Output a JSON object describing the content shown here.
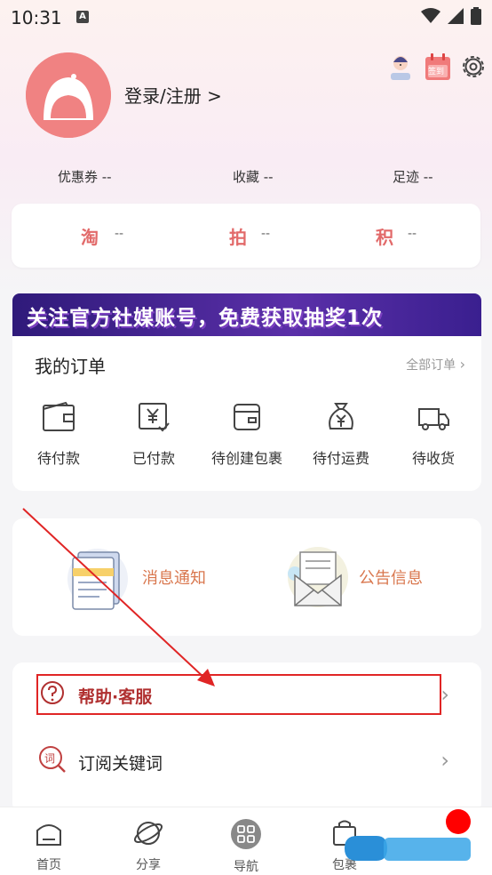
{
  "status_bar": {
    "time": "10:31",
    "notif_letter": "A"
  },
  "profile": {
    "login_text": "登录/注册 >"
  },
  "top_actions": {
    "signin_badge": "签到"
  },
  "stats": [
    {
      "label": "优惠券 --"
    },
    {
      "label": "收藏 --"
    },
    {
      "label": "足迹 --"
    }
  ],
  "tao_card": [
    {
      "name": "淘",
      "value": "--"
    },
    {
      "name": "拍",
      "value": "--"
    },
    {
      "name": "积",
      "value": "--"
    }
  ],
  "banner": {
    "text": "关注官方社媒账号，免费获取抽奖1次"
  },
  "orders": {
    "title": "我的订单",
    "all_label": "全部订单",
    "items": [
      {
        "label": "待付款",
        "icon": "wallet-icon"
      },
      {
        "label": "已付款",
        "icon": "paid-yen-icon"
      },
      {
        "label": "待创建包裹",
        "icon": "package-icon"
      },
      {
        "label": "待付运费",
        "icon": "money-bag-icon"
      },
      {
        "label": "待收货",
        "icon": "truck-icon"
      }
    ]
  },
  "messages": [
    {
      "label": "消息通知",
      "icon": "notification-icon"
    },
    {
      "label": "公告信息",
      "icon": "announcement-icon"
    }
  ],
  "menu": [
    {
      "label": "帮助·客服",
      "icon": "help-icon"
    },
    {
      "label": "订阅关键词",
      "icon": "keyword-icon"
    }
  ],
  "tabs": [
    {
      "label": "首页",
      "icon": "home-icon"
    },
    {
      "label": "分享",
      "icon": "planet-icon"
    },
    {
      "label": "导航",
      "icon": "grid-icon"
    },
    {
      "label": "包裹",
      "icon": "bag-icon"
    }
  ],
  "colors": {
    "accent_red": "#e02525",
    "avatar_pink": "#f08282",
    "tao_red": "#e26a6a",
    "message_orange": "#d9774e"
  }
}
